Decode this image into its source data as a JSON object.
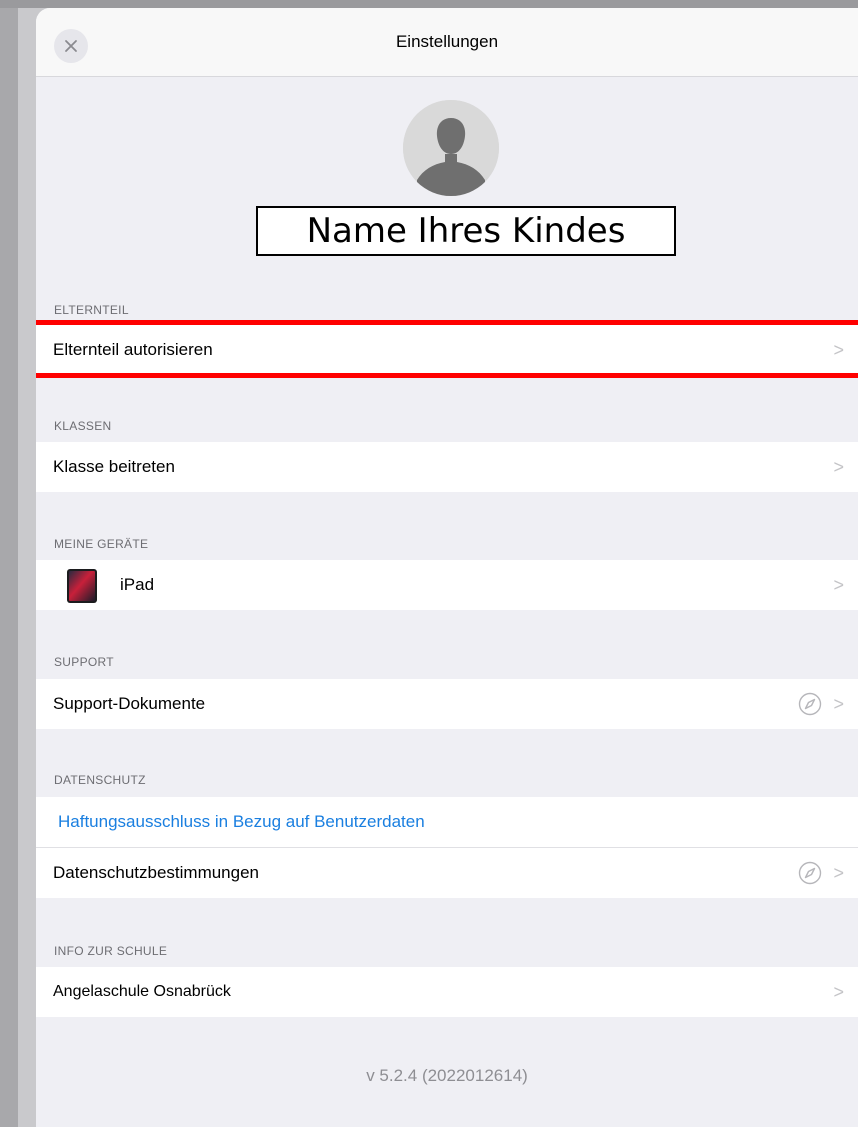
{
  "navbar": {
    "title": "Einstellungen",
    "close_icon": "close-icon"
  },
  "profile": {
    "avatar_icon": "person-silhouette-icon",
    "name": "Name Ihres Kindes"
  },
  "sections": [
    {
      "header": "ELTERNTEIL",
      "rows": [
        {
          "label": "Elternteil autorisieren",
          "highlighted": true
        }
      ]
    },
    {
      "header": "KLASSEN",
      "rows": [
        {
          "label": "Klasse beitreten"
        }
      ]
    },
    {
      "header": "MEINE GERÄTE",
      "rows": [
        {
          "label": "iPad",
          "icon": "ipad-icon"
        }
      ]
    },
    {
      "header": "SUPPORT",
      "rows": [
        {
          "label": "Support-Dokumente",
          "icon": "compass-icon"
        }
      ]
    },
    {
      "header": "DATENSCHUTZ",
      "rows": [
        {
          "label": "Haftungsausschluss in Bezug auf Benutzerdaten",
          "link": true
        },
        {
          "label": "Datenschutzbestimmungen",
          "icon": "compass-icon"
        }
      ]
    },
    {
      "header": "INFO ZUR SCHULE",
      "rows": [
        {
          "label": "Angelaschule Osnabrück"
        }
      ]
    }
  ],
  "version": "v 5.2.4 (2022012614)",
  "colors": {
    "link": "#1a7fe0",
    "highlight": "#ff0000",
    "background": "#efeff4"
  },
  "chevron": ">"
}
